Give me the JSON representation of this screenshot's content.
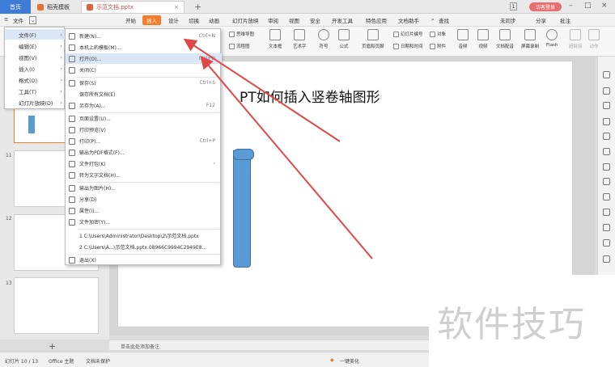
{
  "tabs": {
    "home": "首页",
    "template": "稻壳模板",
    "document": "示范文档.pptx",
    "new_tab": "+",
    "badge": "1",
    "login": "访客登录"
  },
  "menubar": {
    "file": "文件",
    "items": [
      "开始",
      "插入",
      "设计",
      "切换",
      "动画",
      "幻灯片放映",
      "审阅",
      "视图",
      "安全",
      "开发工具",
      "特色应用",
      "文档助手"
    ],
    "active": "插入",
    "search": "查找",
    "sync": "未同步",
    "share": "分享",
    "comment": "批注"
  },
  "ribbon": {
    "mind_map": "思维导图",
    "flowchart": "流程图",
    "textbox": "文本框",
    "art_text": "艺术字",
    "symbol": "符号",
    "formula": "公式",
    "header_footer": "页眉和页脚",
    "slide_number": "幻灯片编号",
    "date_time": "日期和时间",
    "object": "对象",
    "attachment": "附件",
    "audio": "音频",
    "video": "视频",
    "doc_audio": "文档配音",
    "screen_record": "屏幕录制",
    "flash": "Flash",
    "hyperlink": "超链接",
    "action": "动作"
  },
  "file_menu": [
    {
      "label": "文件(F)",
      "arrow": true
    },
    {
      "label": "编辑(E)",
      "arrow": true
    },
    {
      "label": "视图(V)",
      "arrow": true
    },
    {
      "label": "插入(I)",
      "arrow": true
    },
    {
      "label": "格式(O)",
      "arrow": true
    },
    {
      "label": "工具(T)",
      "arrow": true
    },
    {
      "label": "幻灯片放映(D)",
      "arrow": true
    }
  ],
  "submenu": [
    {
      "label": "新建(N)...",
      "shortcut": "Ctrl+N"
    },
    {
      "label": "本机上的模板(M)...",
      "shortcut": ""
    },
    {
      "label": "打开(O)...",
      "shortcut": "Ctrl+O"
    },
    {
      "label": "关闭(C)",
      "shortcut": ""
    },
    {
      "label": "保存(S)",
      "shortcut": "Ctrl+S"
    },
    {
      "label": "保存所有文档(E)",
      "shortcut": ""
    },
    {
      "label": "另存为(A)...",
      "shortcut": "F12"
    },
    {
      "label": "页面设置(U)...",
      "shortcut": ""
    },
    {
      "label": "打印预览(V)",
      "shortcut": ""
    },
    {
      "label": "打印(P)...",
      "shortcut": "Ctrl+P"
    },
    {
      "label": "输出为PDF格式(F)...",
      "shortcut": ""
    },
    {
      "label": "文件打包(K)",
      "shortcut": "›"
    },
    {
      "label": "转为文字文档(H)...",
      "shortcut": ""
    },
    {
      "label": "输出为图片(H)...",
      "shortcut": ""
    },
    {
      "label": "分享(D)",
      "shortcut": ""
    },
    {
      "label": "属性(I)...",
      "shortcut": ""
    },
    {
      "label": "文件加密(Y)...",
      "shortcut": ""
    },
    {
      "label": "1 C:\\Users\\Administrator\\Desktop\\2\\示范文档.pptx",
      "shortcut": ""
    },
    {
      "label": "2 C:\\Users\\A...\\示范文档.pptx.08966C9994C2949E8...",
      "shortcut": ""
    },
    {
      "label": "退出(X)",
      "shortcut": ""
    }
  ],
  "slides": {
    "numbers": [
      "11",
      "12",
      "13"
    ],
    "add": "+"
  },
  "main_slide": {
    "title": "PT如何插入竖卷轴图形"
  },
  "notes": "单击此处添加备注",
  "status": {
    "slide_counter": "幻灯片 10 / 13",
    "theme": "Office 主题",
    "protect": "文档未保护",
    "beautify": "一键美化"
  },
  "watermark": "软件技巧",
  "colors": {
    "accent_orange": "#f57c2a",
    "home_blue": "#3d7bd6",
    "scroll_blue": "#5b9bd5",
    "arrow_red": "#e04848"
  }
}
